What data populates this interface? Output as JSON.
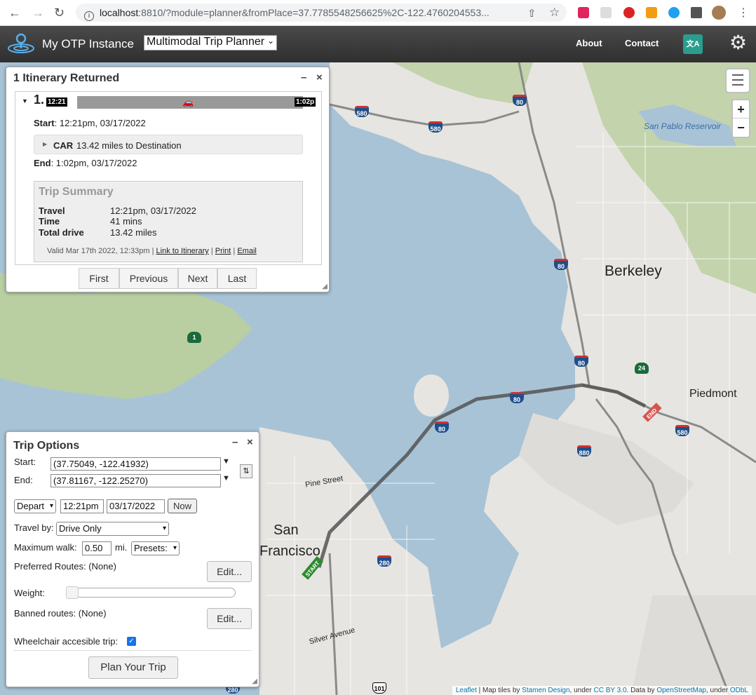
{
  "browser": {
    "url_host": "localhost",
    "url_rest": ":8810/?module=planner&fromPlace=37.7785548256625%2C-122.4760204553..."
  },
  "header": {
    "app_title": "My OTP Instance",
    "module_selected": "Multimodal Trip Planner",
    "about": "About",
    "contact": "Contact"
  },
  "itinerary_panel": {
    "title": "1 Itinerary Returned",
    "minimize": "–",
    "close": "×",
    "itinerary_number": "1.",
    "start_time_label": "12:21",
    "end_time_label": "1:02p",
    "start_key": "Start",
    "start_value": ": 12:21pm, 03/17/2022",
    "leg_mode": "CAR",
    "leg_desc": "13.42 miles to Destination",
    "end_key": "End",
    "end_value": ": 1:02pm, 03/17/2022",
    "summary_title": "Trip Summary",
    "summary": [
      {
        "key": "Travel",
        "value": "12:21pm, 03/17/2022"
      },
      {
        "key": "Time",
        "value": "41 mins"
      },
      {
        "key": "Total drive",
        "value": "13.42 miles"
      }
    ],
    "valid_text": "Valid Mar 17th 2022, 12:33pm |",
    "link_itinerary": "Link to Itinerary",
    "print": "Print",
    "email": "Email",
    "sep": "|",
    "pager": [
      "First",
      "Previous",
      "Next",
      "Last"
    ]
  },
  "trip_options": {
    "title": "Trip Options",
    "minimize": "–",
    "close": "×",
    "start_label": "Start:",
    "start_value": "(37.75049, -122.41932)",
    "end_label": "End:",
    "end_value": "(37.81167, -122.25270)",
    "depart_value": "Depart",
    "time_value": "12:21pm",
    "date_value": "03/17/2022",
    "now_button": "Now",
    "travel_by_label": "Travel by:",
    "travel_by_value": "Drive Only",
    "max_walk_label": "Maximum walk:",
    "max_walk_value": "0.50",
    "max_walk_unit": "mi.",
    "presets_value": "Presets:",
    "preferred_routes_label": "Preferred Routes: (None)",
    "edit_label": "Edit...",
    "weight_label": "Weight:",
    "weight_fraction": 0.0,
    "banned_routes_label": "Banned routes: (None)",
    "wheelchair_label": "Wheelchair accesible trip:",
    "wheelchair_checked": true,
    "plan_button": "Plan Your Trip"
  },
  "map": {
    "labels": {
      "berkeley": "Berkeley",
      "piedmont": "Piedmont",
      "san": "San",
      "francisco": "Francisco",
      "reservoir": "San Pablo Reservoir",
      "pine_street": "Pine Street",
      "silver_avenue": "Silver Avenue"
    },
    "shields": [
      "580",
      "580",
      "80",
      "80",
      "80",
      "80",
      "1",
      "24",
      "880",
      "580",
      "80",
      "280",
      "280",
      "101"
    ],
    "start_marker": "START",
    "end_marker": "END",
    "zoom_in": "+",
    "zoom_out": "−",
    "attribution": {
      "leaflet": "Leaflet",
      "t1": "| Map tiles by",
      "stamen": "Stamen Design",
      "t2": ", under",
      "ccby": "CC BY 3.0",
      "t3": ". Data by",
      "osm": "OpenStreetMap",
      "t4": ", under",
      "odbl": "ODbL"
    }
  },
  "colors": {
    "water": "#a8c3d6",
    "land": "#e8e6e2",
    "park": "#b9cfa1",
    "route": "#555555",
    "start_marker": "#2e8b2e",
    "end_marker": "#d9534f"
  }
}
